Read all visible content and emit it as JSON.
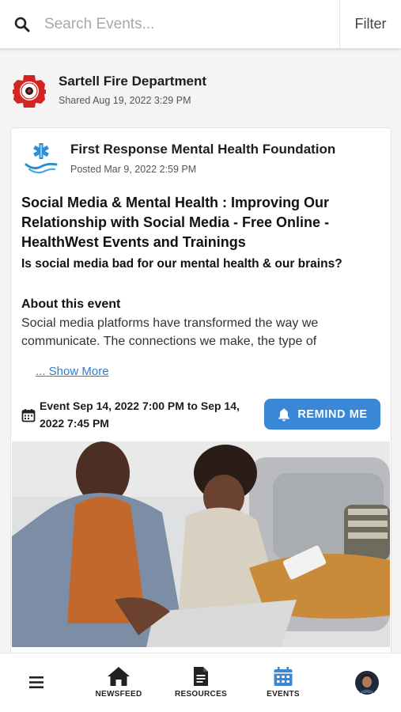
{
  "search": {
    "placeholder": "Search Events...",
    "icon": "search-icon"
  },
  "filter": {
    "label": "Filter"
  },
  "share": {
    "org_name": "Sartell Fire Department",
    "meta": "Shared Aug 19, 2022 3:29 PM"
  },
  "post": {
    "org_name": "First Response Mental Health Foundation",
    "meta": "Posted Mar 9, 2022 2:59 PM",
    "title": "Social Media & Mental Health : Improving Our Relationship with Social Media - Free Online - HealthWest Events and Trainings",
    "subtitle": "Is social media bad for our mental health & our brains?",
    "about_heading": "About this event",
    "about_body": "Social media platforms have transformed the way we communicate. The connections we make, the type of",
    "show_more": "... Show More",
    "event_time": "Event Sep 14, 2022 7:00 PM to Sep 14, 2022 7:45 PM",
    "remind_label": "REMIND ME"
  },
  "nav": {
    "newsfeed": "NEWSFEED",
    "resources": "RESOURCES",
    "events": "EVENTS"
  },
  "colors": {
    "accent": "#3a87d8",
    "fire_red": "#d32424",
    "link": "#2f7ccf",
    "active_nav": "#3a87d8"
  }
}
